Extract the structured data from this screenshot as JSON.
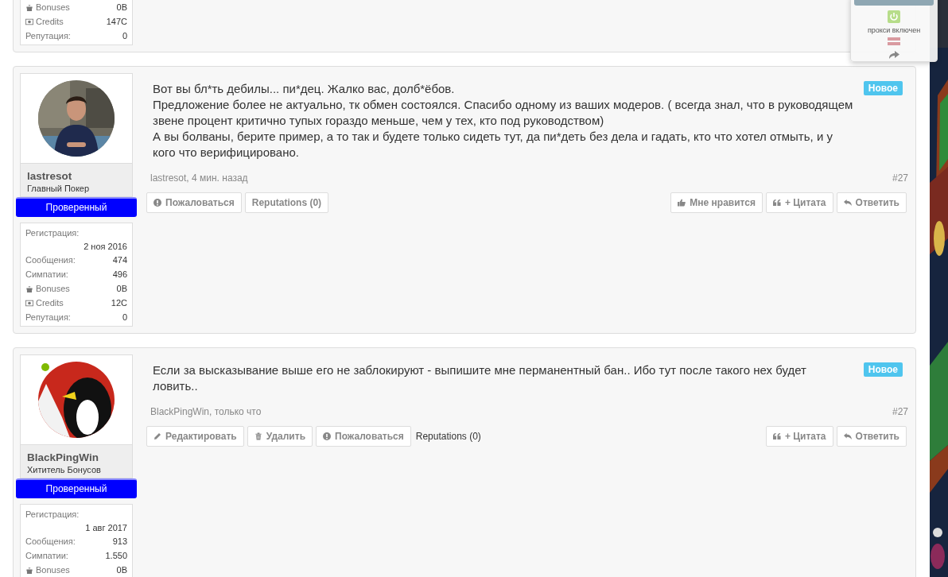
{
  "previous_post": {
    "stats": [
      {
        "kind": "bonuses",
        "label": "Bonuses",
        "value": "0B"
      },
      {
        "kind": "credits",
        "label": "Credits",
        "value": "147C"
      },
      {
        "kind": "plain",
        "label": "Репутация:",
        "value": "0"
      }
    ]
  },
  "posts": [
    {
      "user": {
        "name": "lastresot",
        "title": "Главный Покер",
        "badge": "Проверенный",
        "online": false
      },
      "stats": [
        {
          "kind": "stacked",
          "label": "Регистрация:",
          "value": "2 ноя 2016"
        },
        {
          "kind": "plain",
          "label": "Сообщения:",
          "value": "474"
        },
        {
          "kind": "plain",
          "label": "Симпатии:",
          "value": "496"
        },
        {
          "kind": "bonuses",
          "label": "Bonuses",
          "value": "0B"
        },
        {
          "kind": "credits",
          "label": "Credits",
          "value": "12C"
        },
        {
          "kind": "plain",
          "label": "Репутация:",
          "value": "0"
        }
      ],
      "message": "Вот вы бл*ть дебилы... пи*дец. Жалко вас, долб*ёбов.\nПредложение более не актуально, тк обмен состоялся. Спасибо одному из ваших модеров. ( всегда знал, что в руководящем звене процент критично тупых гораздо меньше, чем у тех, кто под руководством)\nА вы болваны, берите пример, а то так и будете только сидеть тут, да пи*деть без дела и гадать, кто что хотел отмыть, и у кого что верифицировано.",
      "new_label": "Новое",
      "meta": "lastresot, 4 мин. назад",
      "number": "#27",
      "left_actions": [
        {
          "kind": "report",
          "label": "Пожаловаться",
          "boxed": true
        },
        {
          "kind": "plain",
          "label": "Reputations (0)",
          "boxed": true
        }
      ],
      "right_actions": [
        {
          "kind": "like",
          "label": "Мне нравится"
        },
        {
          "kind": "quote",
          "label": "+ Цитата"
        },
        {
          "kind": "reply",
          "label": "Ответить"
        }
      ]
    },
    {
      "user": {
        "name": "BlackPingWin",
        "title": "Хититель Бонусов",
        "badge": "Проверенный",
        "online": true
      },
      "stats": [
        {
          "kind": "stacked",
          "label": "Регистрация:",
          "value": "1 авг 2017"
        },
        {
          "kind": "plain",
          "label": "Сообщения:",
          "value": "913"
        },
        {
          "kind": "plain",
          "label": "Симпатии:",
          "value": "1.550"
        },
        {
          "kind": "bonuses",
          "label": "Bonuses",
          "value": "0B"
        }
      ],
      "message": "Если за высказывание выше его не заблокируют - выпишите мне перманентный бан.. Ибо тут после такого нех будет ловить..",
      "new_label": "Новое",
      "meta": "BlackPingWin, только что",
      "number": "#27",
      "left_actions": [
        {
          "kind": "edit",
          "label": "Редактировать",
          "boxed": true
        },
        {
          "kind": "delete",
          "label": "Удалить",
          "boxed": true
        },
        {
          "kind": "report",
          "label": "Пожаловаться",
          "boxed": true
        },
        {
          "kind": "plain",
          "label": "Reputations (0)",
          "boxed": false
        }
      ],
      "right_actions": [
        {
          "kind": "quote",
          "label": "+ Цитата"
        },
        {
          "kind": "reply",
          "label": "Ответить"
        }
      ]
    }
  ],
  "proxy_widget": {
    "status": "прокси включен"
  }
}
